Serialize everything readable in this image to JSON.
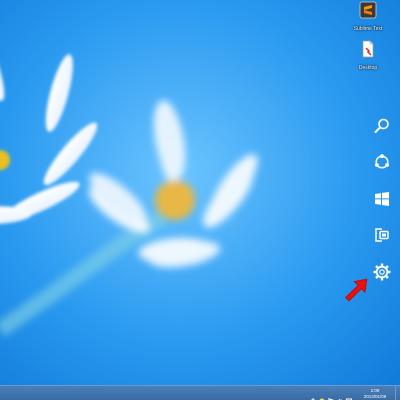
{
  "desktop": {
    "icons": [
      {
        "label": "Sublime Text",
        "icon": "sublime-text-icon"
      },
      {
        "label": "Desktop",
        "icon": "desktop-file-icon"
      }
    ]
  },
  "charms": [
    {
      "name": "Search",
      "icon": "search-icon"
    },
    {
      "name": "Share",
      "icon": "share-icon"
    },
    {
      "name": "Start",
      "icon": "windows-logo-icon"
    },
    {
      "name": "Devices",
      "icon": "devices-icon"
    },
    {
      "name": "Settings",
      "icon": "gear-icon"
    }
  ],
  "annotation": {
    "icon": "red-arrow-icon",
    "color": "#e81010"
  },
  "taskbar": {
    "clock": {
      "time": "1:09",
      "date": "2013/01/09"
    },
    "tray_icons": [
      "network-icon",
      "action-center-icon",
      "flag-icon",
      "volume-icon",
      "ime-icon"
    ]
  },
  "colors": {
    "sky": "#1e90e8",
    "taskbar": "#3a6ca4",
    "accent_arrow": "#e81010"
  }
}
